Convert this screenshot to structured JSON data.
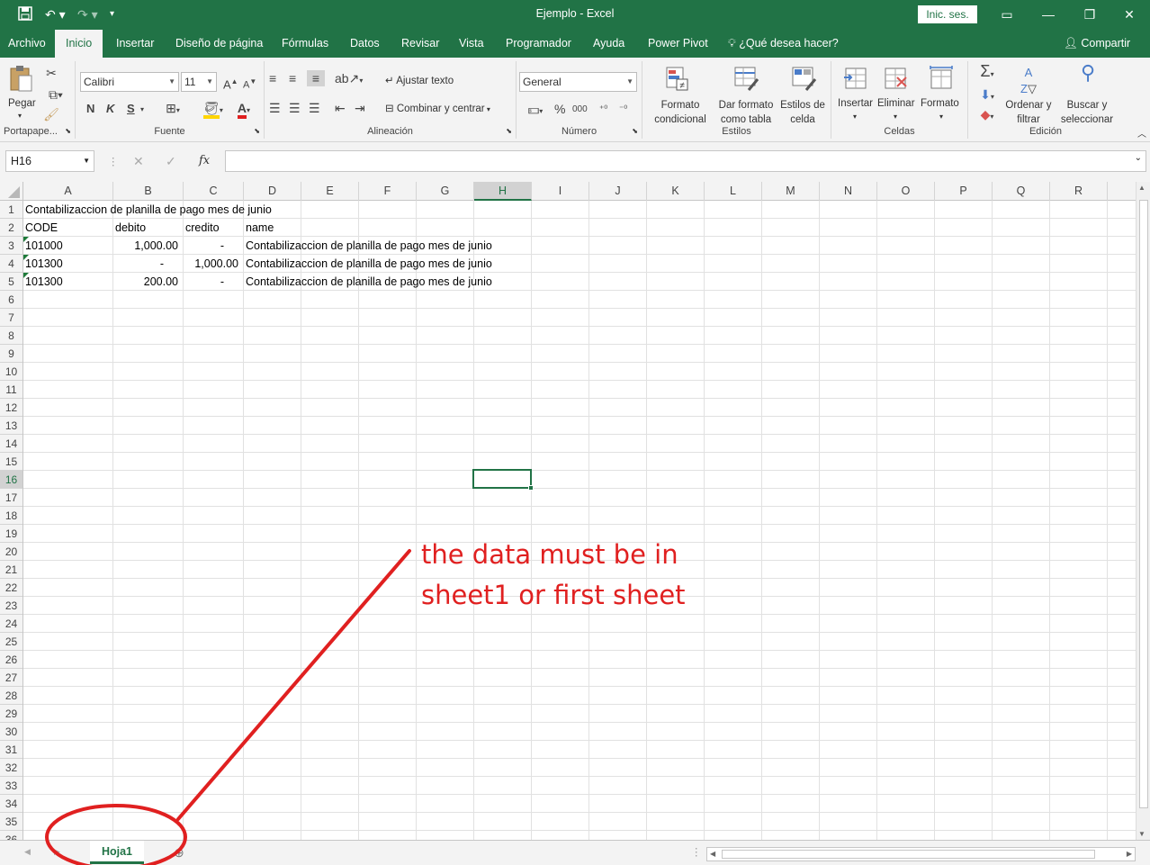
{
  "window": {
    "title": "Ejemplo  -  Excel",
    "signin": "Inic. ses."
  },
  "tabs": [
    "Archivo",
    "Inicio",
    "Insertar",
    "Diseño de página",
    "Fórmulas",
    "Datos",
    "Revisar",
    "Vista",
    "Programador",
    "Ayuda",
    "Power Pivot"
  ],
  "tellme": "¿Qué desea hacer?",
  "share": "Compartir",
  "ribbon": {
    "clipboard": {
      "paste": "Pegar",
      "label": "Portapape..."
    },
    "font": {
      "name": "Calibri",
      "size": "11",
      "bold": "N",
      "italic": "K",
      "underline": "S",
      "label": "Fuente"
    },
    "alignment": {
      "wrap": "Ajustar texto",
      "merge": "Combinar y centrar",
      "label": "Alineación"
    },
    "number": {
      "format": "General",
      "label": "Número"
    },
    "styles": {
      "conditional": "Formato condicional",
      "astable": "Dar formato como tabla",
      "cellstyles": "Estilos de celda",
      "label": "Estilos"
    },
    "cells": {
      "insert": "Insertar",
      "delete": "Eliminar",
      "format": "Formato",
      "label": "Celdas"
    },
    "editing": {
      "sort": "Ordenar y filtrar",
      "find": "Buscar y seleccionar",
      "label": "Edición"
    }
  },
  "namebox": "H16",
  "formula": "",
  "columns": [
    "A",
    "B",
    "C",
    "D",
    "E",
    "F",
    "G",
    "H",
    "I",
    "J",
    "K",
    "L",
    "M",
    "N",
    "O",
    "P",
    "Q",
    "R"
  ],
  "selected_column": "H",
  "selected_row": "16",
  "rows": [
    "1",
    "2",
    "3",
    "4",
    "5",
    "6",
    "7",
    "8",
    "9",
    "10",
    "11",
    "12",
    "13",
    "14",
    "15",
    "16",
    "17",
    "18",
    "19",
    "20",
    "21",
    "22",
    "23",
    "24",
    "25",
    "26",
    "27",
    "28",
    "29",
    "30",
    "31",
    "32",
    "33",
    "34",
    "35",
    "36"
  ],
  "cells": {
    "A1": "Contabilizaccion de planilla de pago mes de junio",
    "A2": "CODE",
    "B2": "debito",
    "C2": "credito",
    "D2": "name",
    "A3": "101000",
    "B3": "1,000.00",
    "C3": "-",
    "D3": "Contabilizaccion de planilla de pago mes de junio",
    "A4": "101300",
    "B4": "-",
    "C4": "1,000.00",
    "D4": "Contabilizaccion de planilla de pago mes de junio",
    "A5": "101300",
    "B5": "200.00",
    "C5": "-",
    "D5": "Contabilizaccion de planilla de pago mes de junio"
  },
  "sheet_tab": "Hoja1",
  "annotation": {
    "line1": "the data must be in",
    "line2": "sheet1 or first sheet",
    "color": "#e02020"
  },
  "colors": {
    "accent": "#217346"
  }
}
